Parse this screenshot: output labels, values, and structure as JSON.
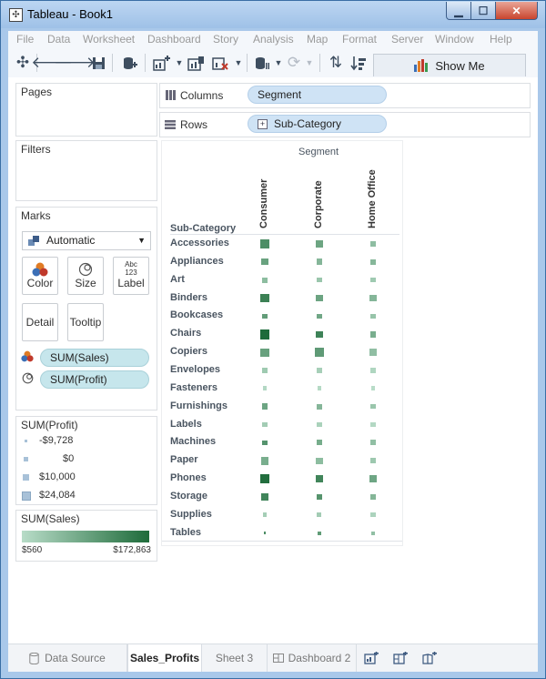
{
  "window": {
    "title": "Tableau - Book1"
  },
  "menu": [
    "File",
    "Data",
    "Worksheet",
    "Dashboard",
    "Story",
    "Analysis",
    "Map",
    "Format",
    "Server",
    "Window",
    "Help"
  ],
  "toolbar": {
    "show_me": "Show Me"
  },
  "panels": {
    "pages": "Pages",
    "filters": "Filters",
    "marks": "Marks"
  },
  "marks": {
    "type": "Automatic",
    "cards": {
      "color": "Color",
      "size": "Size",
      "label": "Label",
      "label_glyph_top": "Abc",
      "label_glyph_bottom": "123",
      "detail": "Detail",
      "tooltip": "Tooltip"
    },
    "fields": [
      "SUM(Sales)",
      "SUM(Profit)"
    ]
  },
  "legends": {
    "profit": {
      "title": "SUM(Profit)",
      "items": [
        "-$9,728",
        "$0",
        "$10,000",
        "$24,084"
      ]
    },
    "sales": {
      "title": "SUM(Sales)",
      "min": "$560",
      "max": "$172,863",
      "color_low": "#b8dcc8",
      "color_high": "#1e6b3a"
    }
  },
  "shelves": {
    "columns_label": "Columns",
    "columns_pill": "Segment",
    "rows_label": "Rows",
    "rows_pill": "Sub-Category"
  },
  "view": {
    "col_header": "Segment",
    "row_header": "Sub-Category",
    "segments": [
      "Consumer",
      "Corporate",
      "Home Office"
    ]
  },
  "chart_data": {
    "type": "heatmap",
    "x": [
      "Consumer",
      "Corporate",
      "Home Office"
    ],
    "y": [
      "Accessories",
      "Appliances",
      "Art",
      "Binders",
      "Bookcases",
      "Chairs",
      "Copiers",
      "Envelopes",
      "Fasteners",
      "Furnishings",
      "Labels",
      "Machines",
      "Paper",
      "Phones",
      "Storage",
      "Supplies",
      "Tables"
    ],
    "size_measure": "SUM(Profit)",
    "color_measure": "SUM(Sales)",
    "profit": [
      [
        20700,
        12000,
        9000
      ],
      [
        9400,
        8500,
        5300
      ],
      [
        4600,
        1900,
        2100
      ],
      [
        18300,
        9800,
        9400
      ],
      [
        1700,
        2500,
        1100
      ],
      [
        24084,
        10600,
        8300
      ],
      [
        18500,
        20000,
        14800
      ],
      [
        3400,
        2000,
        1600
      ],
      [
        800,
        600,
        500
      ],
      [
        7500,
        4600,
        3500
      ],
      [
        2800,
        1500,
        1200
      ],
      [
        3500,
        5600,
        4600
      ],
      [
        16300,
        9500,
        6600
      ],
      [
        23800,
        14500,
        11000
      ],
      [
        11800,
        6500,
        3500
      ],
      [
        -300,
        850,
        1000
      ],
      [
        -9728,
        -3000,
        -4000
      ]
    ],
    "sales": [
      [
        94000,
        53000,
        20000
      ],
      [
        57000,
        28000,
        27000
      ],
      [
        21000,
        12000,
        9000
      ],
      [
        121000,
        54000,
        28000
      ],
      [
        65000,
        49000,
        14000
      ],
      [
        172863,
        117000,
        39000
      ],
      [
        59000,
        70000,
        19000
      ],
      [
        9000,
        5000,
        2000
      ],
      [
        1100,
        800,
        560
      ],
      [
        52000,
        28000,
        12000
      ],
      [
        7000,
        3700,
        1200
      ],
      [
        83000,
        41000,
        18000
      ],
      [
        39000,
        21000,
        10000
      ],
      [
        165000,
        113000,
        51000
      ],
      [
        112000,
        82000,
        29000
      ],
      [
        6000,
        7000,
        3000
      ],
      [
        95000,
        68000,
        18000
      ]
    ],
    "size_range": [
      -9728,
      24084
    ],
    "color_range": [
      560,
      172863
    ]
  },
  "tabs": {
    "data_source": "Data Source",
    "sheet1": "Sales_Profits",
    "sheet2": "Sheet 3",
    "dashboard": "Dashboard 2"
  }
}
